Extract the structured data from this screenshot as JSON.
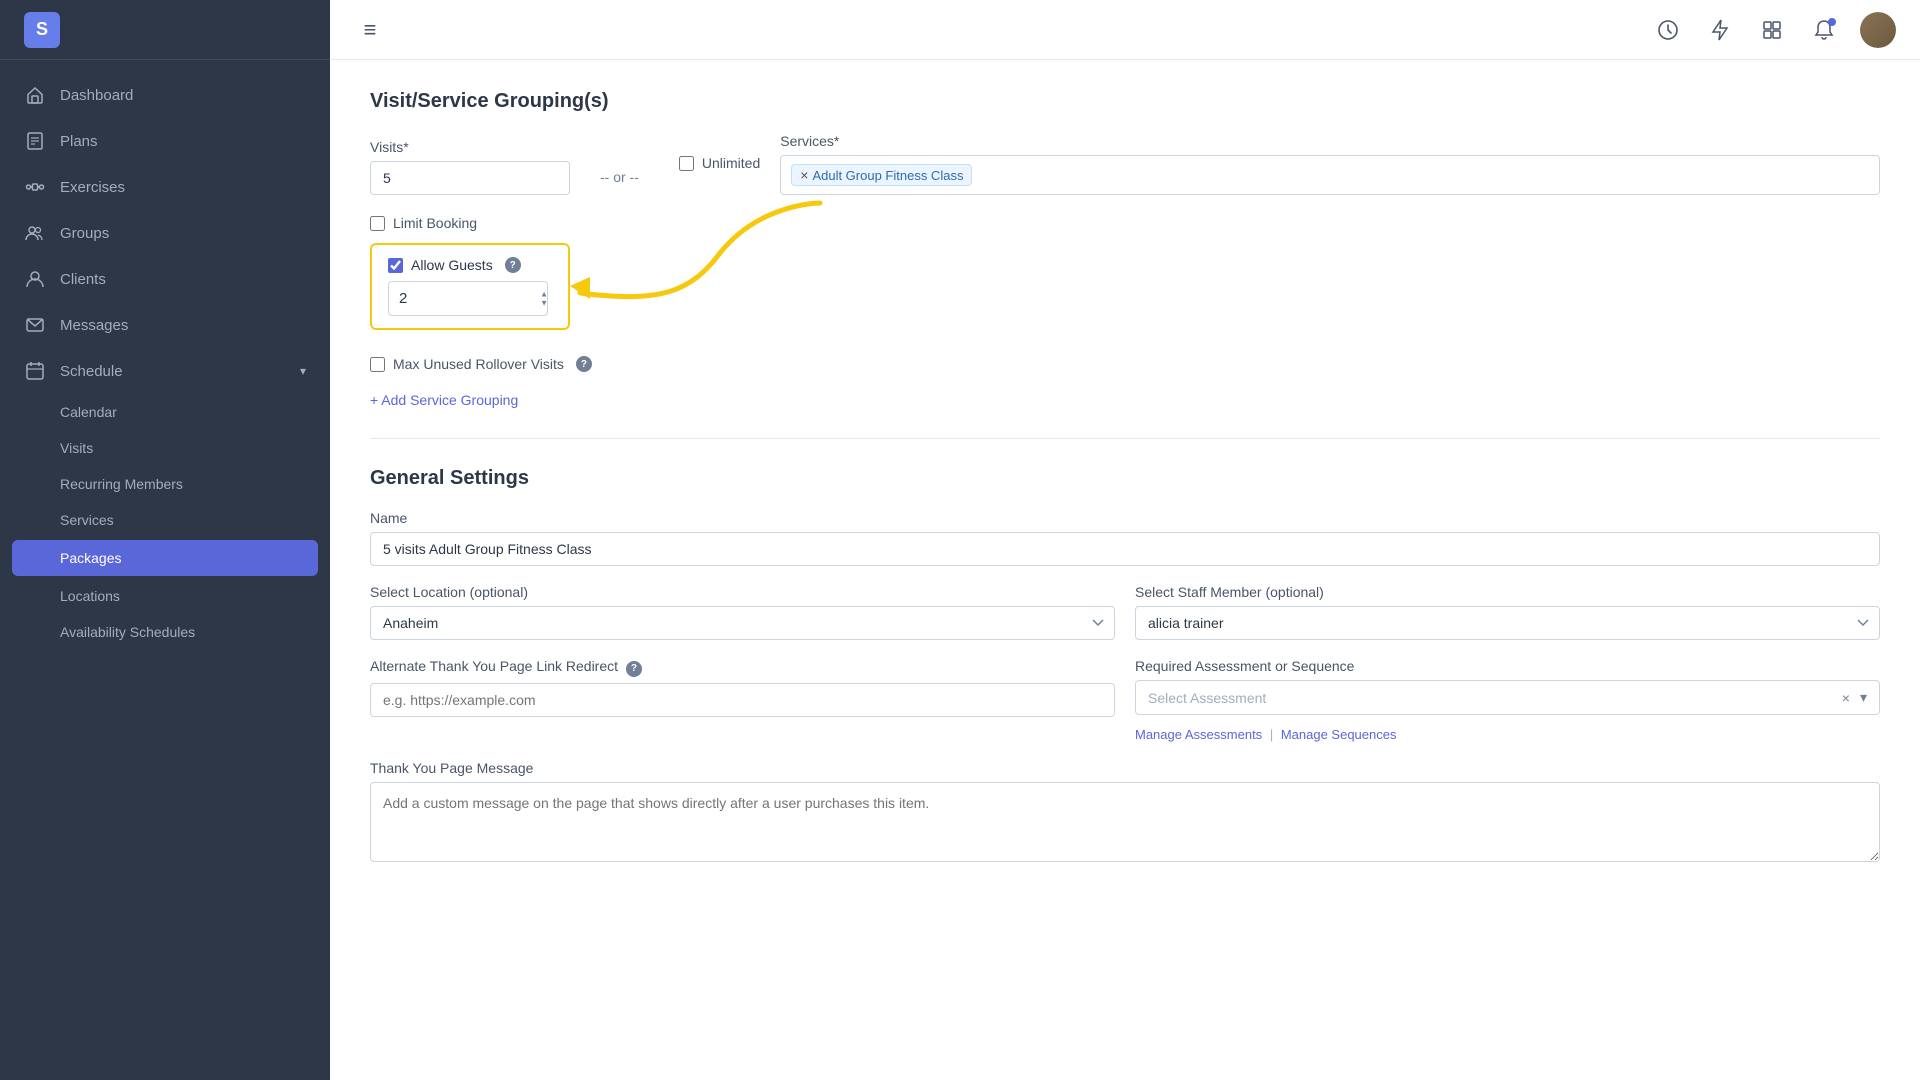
{
  "sidebar": {
    "items": [
      {
        "id": "dashboard",
        "label": "Dashboard",
        "icon": "🏠"
      },
      {
        "id": "plans",
        "label": "Plans",
        "icon": "📋"
      },
      {
        "id": "exercises",
        "label": "Exercises",
        "icon": "🏋️"
      },
      {
        "id": "groups",
        "label": "Groups",
        "icon": "👥"
      },
      {
        "id": "clients",
        "label": "Clients",
        "icon": "👤"
      },
      {
        "id": "messages",
        "label": "Messages",
        "icon": "✉️"
      },
      {
        "id": "schedule",
        "label": "Schedule",
        "icon": "📅",
        "hasChevron": true
      }
    ],
    "sub_items": [
      {
        "id": "calendar",
        "label": "Calendar"
      },
      {
        "id": "visits",
        "label": "Visits"
      },
      {
        "id": "recurring-members",
        "label": "Recurring Members"
      },
      {
        "id": "services",
        "label": "Services"
      },
      {
        "id": "packages",
        "label": "Packages",
        "active": true
      },
      {
        "id": "locations",
        "label": "Locations"
      },
      {
        "id": "availability-schedules",
        "label": "Availability Schedules"
      }
    ]
  },
  "header": {
    "menu_icon": "≡",
    "icons": [
      "🕐",
      "⚡",
      "⊞"
    ]
  },
  "visit_service_grouping": {
    "title": "Visit/Service Grouping(s)",
    "visits_label": "Visits*",
    "visits_value": "5",
    "or_text": "-- or --",
    "unlimited_label": "Unlimited",
    "services_label": "Services*",
    "service_tag": "Adult Group Fitness Class",
    "limit_booking_label": "Limit Booking",
    "allow_guests_label": "Allow Guests",
    "allow_guests_checked": true,
    "guests_value": "2",
    "max_rollover_label": "Max Unused Rollover Visits",
    "add_grouping_label": "+ Add Service Grouping"
  },
  "general_settings": {
    "title": "General Settings",
    "name_label": "Name",
    "name_value": "5 visits Adult Group Fitness Class",
    "location_label": "Select Location (optional)",
    "location_value": "Anaheim",
    "staff_label": "Select Staff Member (optional)",
    "staff_value": "alicia trainer",
    "alt_thank_you_label": "Alternate Thank You Page Link Redirect",
    "alt_thank_you_placeholder": "e.g. https://example.com",
    "alt_thank_you_help": true,
    "required_assessment_label": "Required Assessment or Sequence",
    "required_assessment_placeholder": "Select Assessment",
    "manage_assessments_label": "Manage Assessments",
    "manage_sequences_label": "Manage Sequences",
    "thank_you_label": "Thank You Page Message",
    "thank_you_placeholder": "Add a custom message on the page that shows directly after a user purchases this item."
  }
}
